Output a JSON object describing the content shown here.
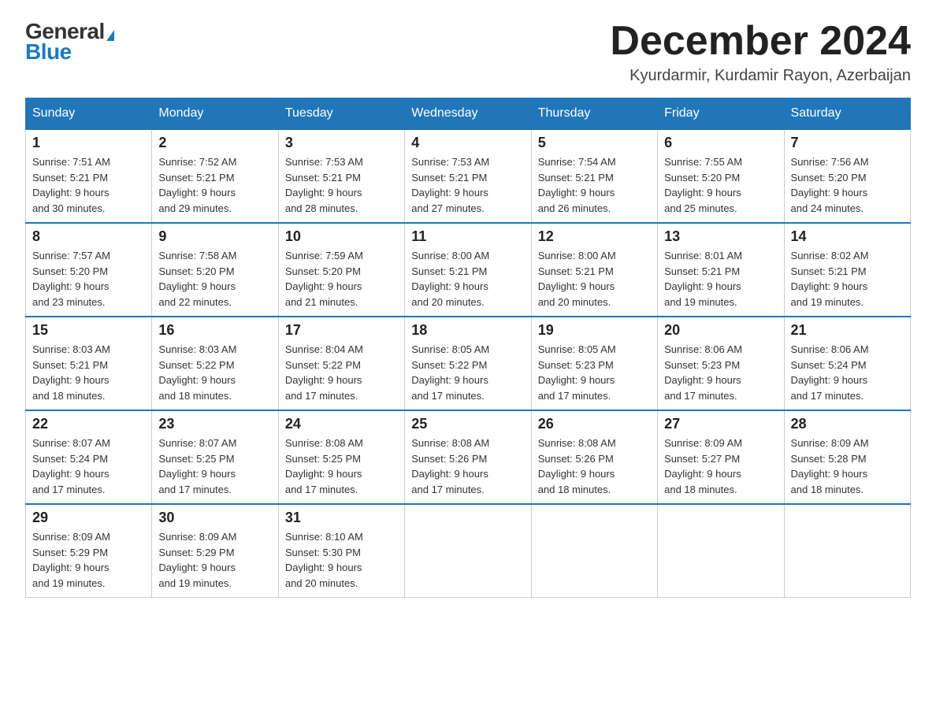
{
  "header": {
    "logo_general": "General",
    "logo_blue": "Blue",
    "month_title": "December 2024",
    "location": "Kyurdarmir, Kurdamir Rayon, Azerbaijan"
  },
  "days_of_week": [
    "Sunday",
    "Monday",
    "Tuesday",
    "Wednesday",
    "Thursday",
    "Friday",
    "Saturday"
  ],
  "weeks": [
    [
      {
        "day": "1",
        "sunrise": "7:51 AM",
        "sunset": "5:21 PM",
        "daylight": "9 hours and 30 minutes."
      },
      {
        "day": "2",
        "sunrise": "7:52 AM",
        "sunset": "5:21 PM",
        "daylight": "9 hours and 29 minutes."
      },
      {
        "day": "3",
        "sunrise": "7:53 AM",
        "sunset": "5:21 PM",
        "daylight": "9 hours and 28 minutes."
      },
      {
        "day": "4",
        "sunrise": "7:53 AM",
        "sunset": "5:21 PM",
        "daylight": "9 hours and 27 minutes."
      },
      {
        "day": "5",
        "sunrise": "7:54 AM",
        "sunset": "5:21 PM",
        "daylight": "9 hours and 26 minutes."
      },
      {
        "day": "6",
        "sunrise": "7:55 AM",
        "sunset": "5:20 PM",
        "daylight": "9 hours and 25 minutes."
      },
      {
        "day": "7",
        "sunrise": "7:56 AM",
        "sunset": "5:20 PM",
        "daylight": "9 hours and 24 minutes."
      }
    ],
    [
      {
        "day": "8",
        "sunrise": "7:57 AM",
        "sunset": "5:20 PM",
        "daylight": "9 hours and 23 minutes."
      },
      {
        "day": "9",
        "sunrise": "7:58 AM",
        "sunset": "5:20 PM",
        "daylight": "9 hours and 22 minutes."
      },
      {
        "day": "10",
        "sunrise": "7:59 AM",
        "sunset": "5:20 PM",
        "daylight": "9 hours and 21 minutes."
      },
      {
        "day": "11",
        "sunrise": "8:00 AM",
        "sunset": "5:21 PM",
        "daylight": "9 hours and 20 minutes."
      },
      {
        "day": "12",
        "sunrise": "8:00 AM",
        "sunset": "5:21 PM",
        "daylight": "9 hours and 20 minutes."
      },
      {
        "day": "13",
        "sunrise": "8:01 AM",
        "sunset": "5:21 PM",
        "daylight": "9 hours and 19 minutes."
      },
      {
        "day": "14",
        "sunrise": "8:02 AM",
        "sunset": "5:21 PM",
        "daylight": "9 hours and 19 minutes."
      }
    ],
    [
      {
        "day": "15",
        "sunrise": "8:03 AM",
        "sunset": "5:21 PM",
        "daylight": "9 hours and 18 minutes."
      },
      {
        "day": "16",
        "sunrise": "8:03 AM",
        "sunset": "5:22 PM",
        "daylight": "9 hours and 18 minutes."
      },
      {
        "day": "17",
        "sunrise": "8:04 AM",
        "sunset": "5:22 PM",
        "daylight": "9 hours and 17 minutes."
      },
      {
        "day": "18",
        "sunrise": "8:05 AM",
        "sunset": "5:22 PM",
        "daylight": "9 hours and 17 minutes."
      },
      {
        "day": "19",
        "sunrise": "8:05 AM",
        "sunset": "5:23 PM",
        "daylight": "9 hours and 17 minutes."
      },
      {
        "day": "20",
        "sunrise": "8:06 AM",
        "sunset": "5:23 PM",
        "daylight": "9 hours and 17 minutes."
      },
      {
        "day": "21",
        "sunrise": "8:06 AM",
        "sunset": "5:24 PM",
        "daylight": "9 hours and 17 minutes."
      }
    ],
    [
      {
        "day": "22",
        "sunrise": "8:07 AM",
        "sunset": "5:24 PM",
        "daylight": "9 hours and 17 minutes."
      },
      {
        "day": "23",
        "sunrise": "8:07 AM",
        "sunset": "5:25 PM",
        "daylight": "9 hours and 17 minutes."
      },
      {
        "day": "24",
        "sunrise": "8:08 AM",
        "sunset": "5:25 PM",
        "daylight": "9 hours and 17 minutes."
      },
      {
        "day": "25",
        "sunrise": "8:08 AM",
        "sunset": "5:26 PM",
        "daylight": "9 hours and 17 minutes."
      },
      {
        "day": "26",
        "sunrise": "8:08 AM",
        "sunset": "5:26 PM",
        "daylight": "9 hours and 18 minutes."
      },
      {
        "day": "27",
        "sunrise": "8:09 AM",
        "sunset": "5:27 PM",
        "daylight": "9 hours and 18 minutes."
      },
      {
        "day": "28",
        "sunrise": "8:09 AM",
        "sunset": "5:28 PM",
        "daylight": "9 hours and 18 minutes."
      }
    ],
    [
      {
        "day": "29",
        "sunrise": "8:09 AM",
        "sunset": "5:29 PM",
        "daylight": "9 hours and 19 minutes."
      },
      {
        "day": "30",
        "sunrise": "8:09 AM",
        "sunset": "5:29 PM",
        "daylight": "9 hours and 19 minutes."
      },
      {
        "day": "31",
        "sunrise": "8:10 AM",
        "sunset": "5:30 PM",
        "daylight": "9 hours and 20 minutes."
      },
      null,
      null,
      null,
      null
    ]
  ],
  "labels": {
    "sunrise": "Sunrise:",
    "sunset": "Sunset:",
    "daylight": "Daylight:"
  }
}
